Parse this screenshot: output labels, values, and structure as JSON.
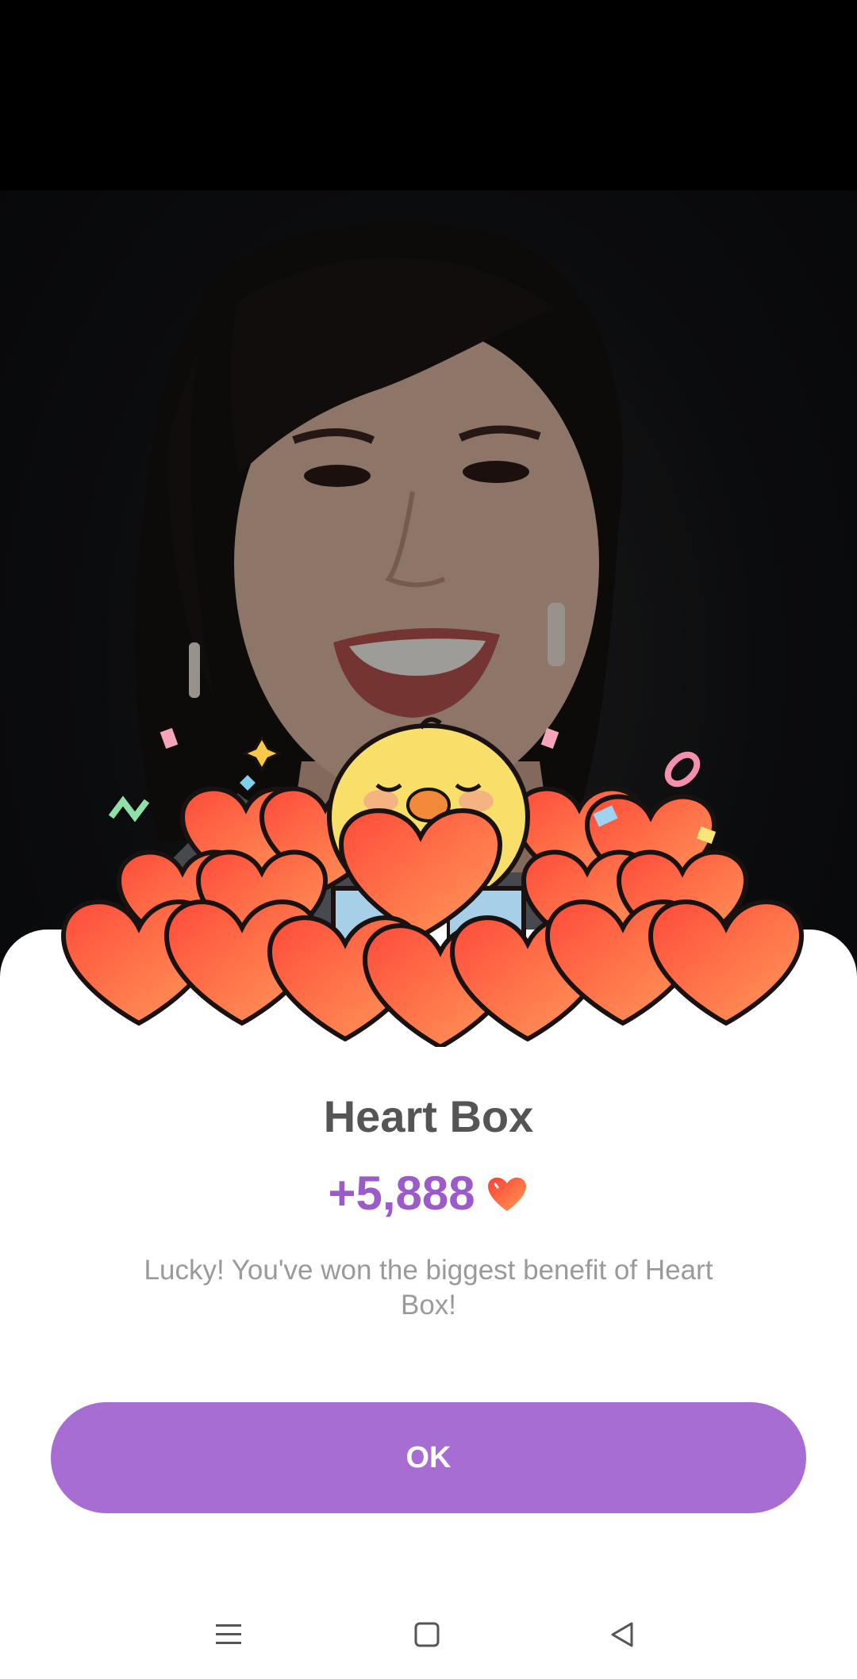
{
  "dialog": {
    "title": "Heart Box",
    "amount": "+5,888",
    "message": "Lucky! You've won the biggest benefit of Heart Box!",
    "ok_label": "OK"
  },
  "icons": {
    "amount_icon": "heart-icon",
    "nav_menu": "menu-icon",
    "nav_home": "square-home-icon",
    "nav_back": "triangle-back-icon"
  },
  "colors": {
    "accent": "#a86dd3",
    "amount": "#9b5bc9",
    "heart": "#ff5a3c",
    "title": "#555555",
    "message": "#9a9a9a"
  }
}
